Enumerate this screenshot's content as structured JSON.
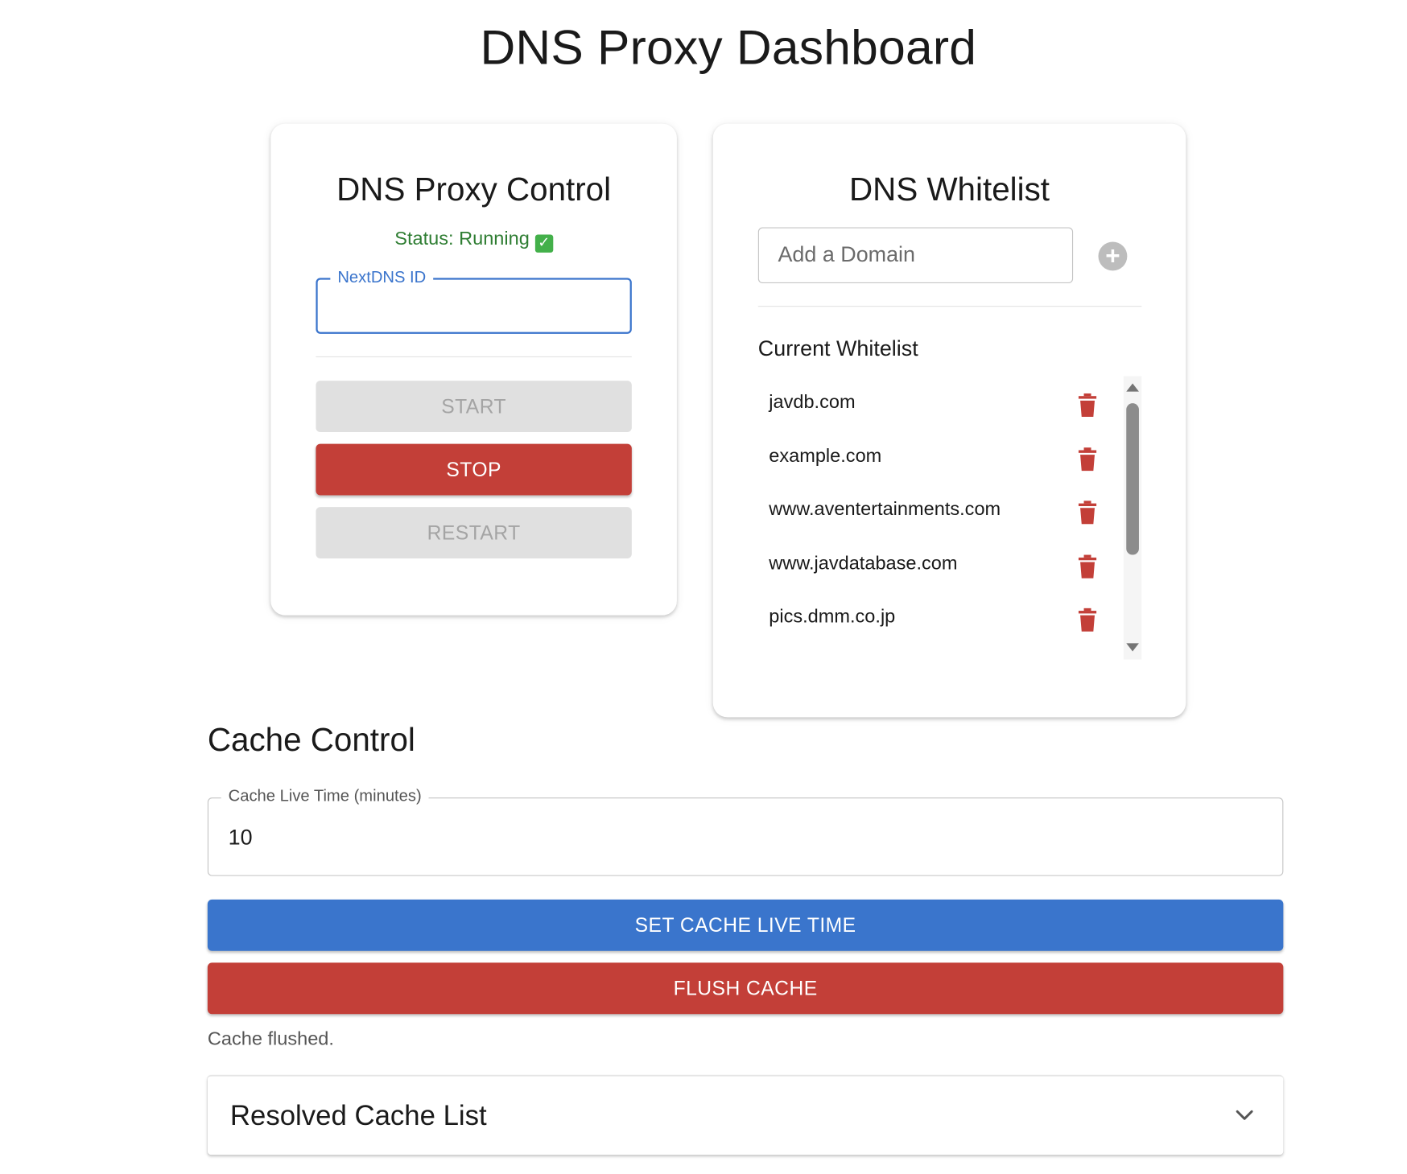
{
  "page": {
    "title": "DNS Proxy Dashboard"
  },
  "control": {
    "title": "DNS Proxy Control",
    "status_text": "Status: Running",
    "status_icon": "check-box-icon",
    "nextdns_label": "NextDNS ID",
    "nextdns_value": "",
    "start_label": "START",
    "stop_label": "STOP",
    "restart_label": "RESTART"
  },
  "whitelist": {
    "title": "DNS Whitelist",
    "input_placeholder": "Add a Domain",
    "add_icon": "add-circle-icon",
    "subtitle": "Current Whitelist",
    "items": [
      {
        "domain": "javdb.com",
        "icon": "trash-icon"
      },
      {
        "domain": "example.com",
        "icon": "trash-icon"
      },
      {
        "domain": "www.aventertainments.com",
        "icon": "trash-icon"
      },
      {
        "domain": "www.javdatabase.com",
        "icon": "trash-icon"
      },
      {
        "domain": "pics.dmm.co.jp",
        "icon": "trash-icon"
      }
    ]
  },
  "cache": {
    "title": "Cache Control",
    "live_time_label": "Cache Live Time (minutes)",
    "live_time_value": "10",
    "set_label": "SET CACHE LIVE TIME",
    "flush_label": "FLUSH CACHE",
    "message": "Cache flushed."
  },
  "resolved": {
    "title": "Resolved Cache List",
    "expand_icon": "chevron-down-icon"
  },
  "colors": {
    "primary": "#3a75cc",
    "danger": "#c33f38",
    "success": "#2e7d32",
    "disabled_bg": "#e0e0e0",
    "disabled_text": "#a4a4a4"
  }
}
